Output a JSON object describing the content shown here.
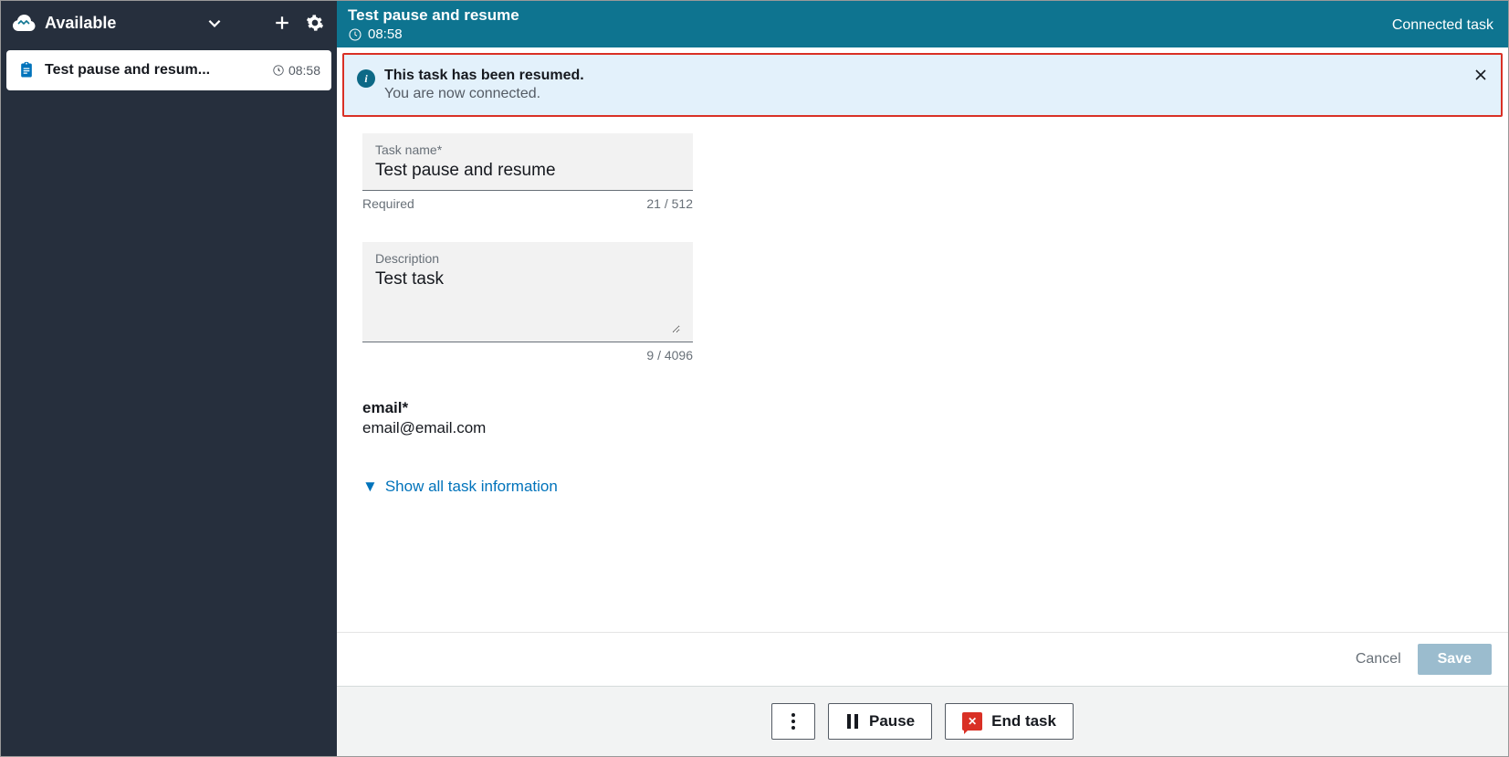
{
  "sidebar": {
    "status": "Available",
    "task": {
      "title": "Test pause and resum...",
      "time": "08:58"
    }
  },
  "header": {
    "title": "Test pause and resume",
    "time": "08:58",
    "status": "Connected task"
  },
  "alert": {
    "title": "This task has been resumed.",
    "body": "You are now connected."
  },
  "form": {
    "task_name_label": "Task name*",
    "task_name_value": "Test pause and resume",
    "task_name_required": "Required",
    "task_name_counter": "21 / 512",
    "description_label": "Description",
    "description_value": "Test task",
    "description_counter": "9 / 4096",
    "email_label": "email*",
    "email_value": "email@email.com",
    "expand_link": "Show all task information"
  },
  "save_bar": {
    "cancel": "Cancel",
    "save": "Save"
  },
  "action_bar": {
    "pause": "Pause",
    "end": "End task"
  }
}
